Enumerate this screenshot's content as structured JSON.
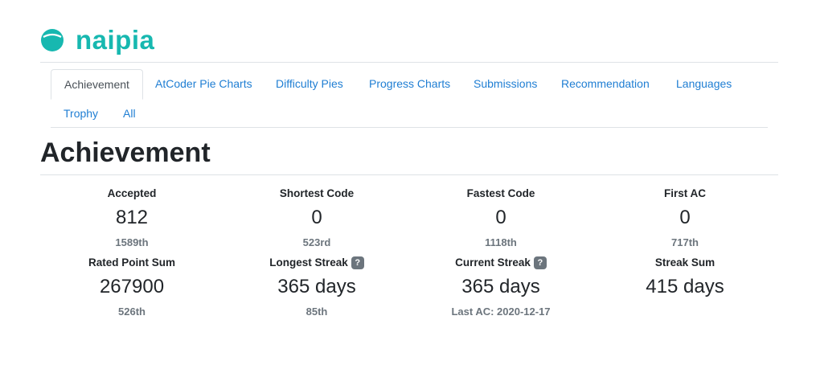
{
  "brand": {
    "name": "naipia",
    "color": "#17b8b0",
    "icon": "circle-logo-icon"
  },
  "nav": {
    "tabs": [
      {
        "label": "Achievement",
        "active": true
      },
      {
        "label": "AtCoder Pie Charts"
      },
      {
        "label": "Difficulty Pies"
      },
      {
        "label": "Progress Charts"
      },
      {
        "label": "Submissions"
      },
      {
        "label": "Recommendation"
      },
      {
        "label": "Languages"
      },
      {
        "label": "Trophy"
      },
      {
        "label": "All"
      }
    ]
  },
  "page": {
    "title": "Achievement"
  },
  "stats": [
    {
      "label": "Accepted",
      "value": "812",
      "sub": "1589th"
    },
    {
      "label": "Shortest Code",
      "value": "0",
      "sub": "523rd"
    },
    {
      "label": "Fastest Code",
      "value": "0",
      "sub": "1118th"
    },
    {
      "label": "First AC",
      "value": "0",
      "sub": "717th"
    },
    {
      "label": "Rated Point Sum",
      "value": "267900",
      "sub": "526th"
    },
    {
      "label": "Longest Streak",
      "value": "365 days",
      "sub": "85th",
      "help": "?"
    },
    {
      "label": "Current Streak",
      "value": "365 days",
      "sub": "Last AC: 2020-12-17",
      "help": "?"
    },
    {
      "label": "Streak Sum",
      "value": "415 days",
      "sub": ""
    }
  ],
  "colors": {
    "link": "#1f7ed3",
    "muted": "#6c757d",
    "border": "#dee2e6"
  }
}
